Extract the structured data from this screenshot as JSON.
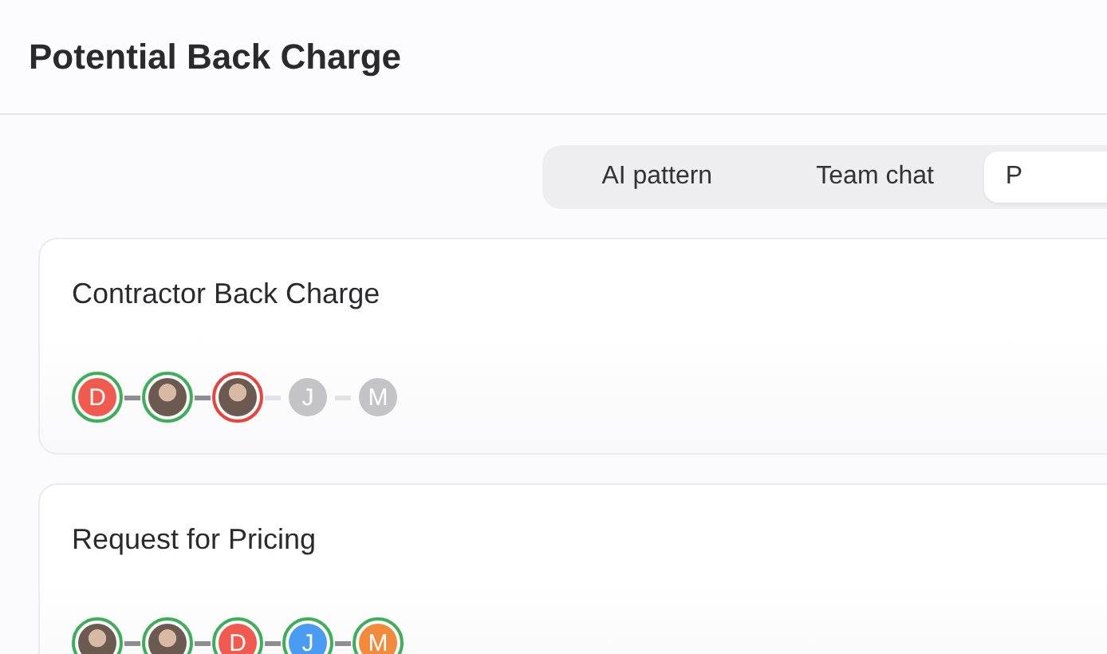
{
  "header": {
    "title": "Potential Back Charge"
  },
  "tabs": [
    {
      "label": "AI pattern",
      "selected": false
    },
    {
      "label": "Team chat",
      "selected": false
    },
    {
      "label": "P",
      "selected": true
    }
  ],
  "cards": [
    {
      "title": "Contractor Back Charge",
      "approvers": [
        {
          "kind": "letter",
          "letter": "D",
          "color": "#f05a4f",
          "approved": true,
          "rejected": false
        },
        {
          "kind": "photo",
          "approved": true,
          "rejected": false
        },
        {
          "kind": "photo",
          "approved": false,
          "rejected": true
        },
        {
          "kind": "letter",
          "letter": "J",
          "color": "#c4c4c6",
          "approved": false,
          "rejected": false
        },
        {
          "kind": "letter",
          "letter": "M",
          "color": "#c4c4c6",
          "approved": false,
          "rejected": false
        }
      ]
    },
    {
      "title": "Request for Pricing",
      "approvers": [
        {
          "kind": "photo",
          "approved": true,
          "rejected": false
        },
        {
          "kind": "photo",
          "approved": true,
          "rejected": false
        },
        {
          "kind": "letter",
          "letter": "D",
          "color": "#f05a4f",
          "approved": true,
          "rejected": false
        },
        {
          "kind": "letter",
          "letter": "J",
          "color": "#4a9cf0",
          "approved": true,
          "rejected": false
        },
        {
          "kind": "letter",
          "letter": "M",
          "color": "#f28a3c",
          "approved": true,
          "rejected": false
        }
      ]
    }
  ]
}
